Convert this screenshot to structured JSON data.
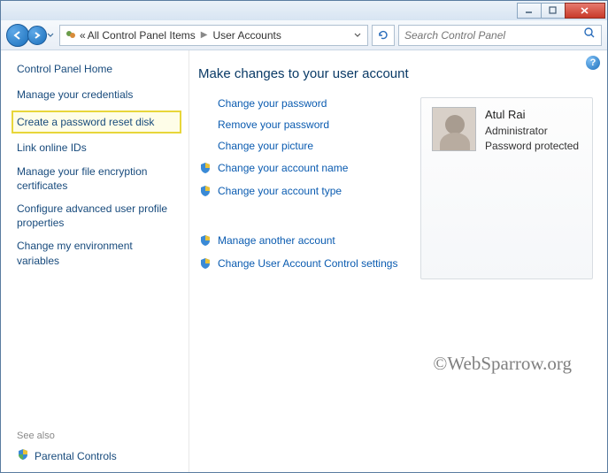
{
  "titlebar": {
    "min": "_",
    "max": "▢",
    "close": "✕"
  },
  "breadcrumb": {
    "root_symbol": "«",
    "item1": "All Control Panel Items",
    "item2": "User Accounts"
  },
  "search": {
    "placeholder": "Search Control Panel"
  },
  "sidebar": {
    "title": "Control Panel Home",
    "links": [
      "Manage your credentials",
      "Create a password reset disk",
      "Link online IDs",
      "Manage your file encryption certificates",
      "Configure advanced user profile properties",
      "Change my environment variables"
    ],
    "seealso": "See also",
    "parental": "Parental Controls"
  },
  "main": {
    "heading": "Make changes to your user account",
    "links": {
      "change_password": "Change your password",
      "remove_password": "Remove your password",
      "change_picture": "Change your picture",
      "change_name": "Change your account name",
      "change_type": "Change your account type",
      "manage_another": "Manage another account",
      "uac_settings": "Change User Account Control settings"
    }
  },
  "user": {
    "name": "Atul Rai",
    "role": "Administrator",
    "protection": "Password protected"
  },
  "watermark": "©WebSparrow.org",
  "help": "?"
}
